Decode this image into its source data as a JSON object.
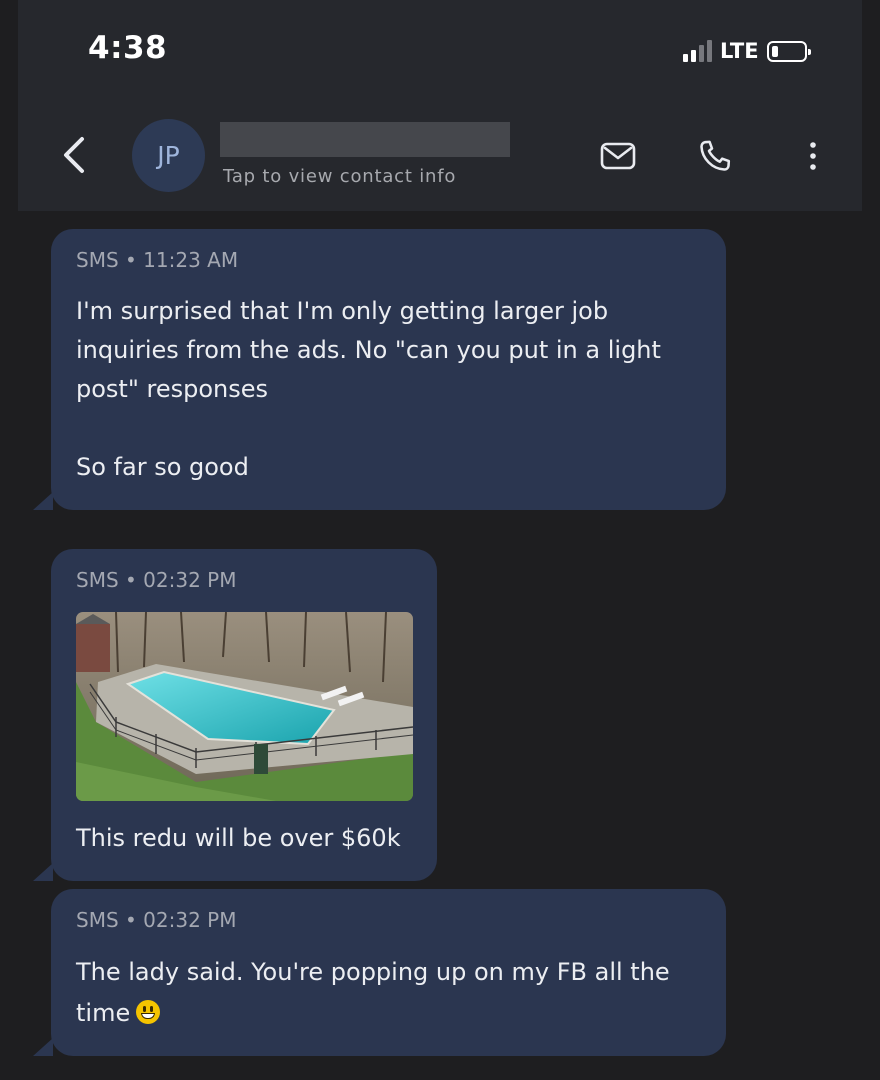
{
  "status_bar": {
    "time": "4:38",
    "network": "LTE",
    "signal_bars_active": 2,
    "signal_bars_total": 4,
    "battery_level": 0.15
  },
  "header": {
    "back_icon": "chevron-left-icon",
    "avatar_initials": "JP",
    "contact_name": "",
    "subtitle": "Tap to view contact info",
    "actions": [
      "mail-icon",
      "phone-icon",
      "more-vertical-icon"
    ]
  },
  "messages": [
    {
      "channel": "SMS",
      "time": "11:23 AM",
      "meta": "SMS • 11:23 AM",
      "text": "I'm surprised that I'm only getting larger job inquiries from the ads. No \"can you put in a light post\" responses\n\nSo far so good"
    },
    {
      "channel": "SMS",
      "time": "02:32 PM",
      "meta": "SMS • 02:32 PM",
      "has_photo": true,
      "text": "This redu will be over $60k"
    },
    {
      "channel": "SMS",
      "time": "02:32 PM",
      "meta": "SMS • 02:32 PM",
      "text": "The lady said. You're popping up on my FB all the time",
      "emoji": "grinning-face-emoji"
    }
  ],
  "colors": {
    "background": "#1e1e20",
    "header": "#26282d",
    "bubble": "#2b3650",
    "avatar": "#2d3a55"
  }
}
